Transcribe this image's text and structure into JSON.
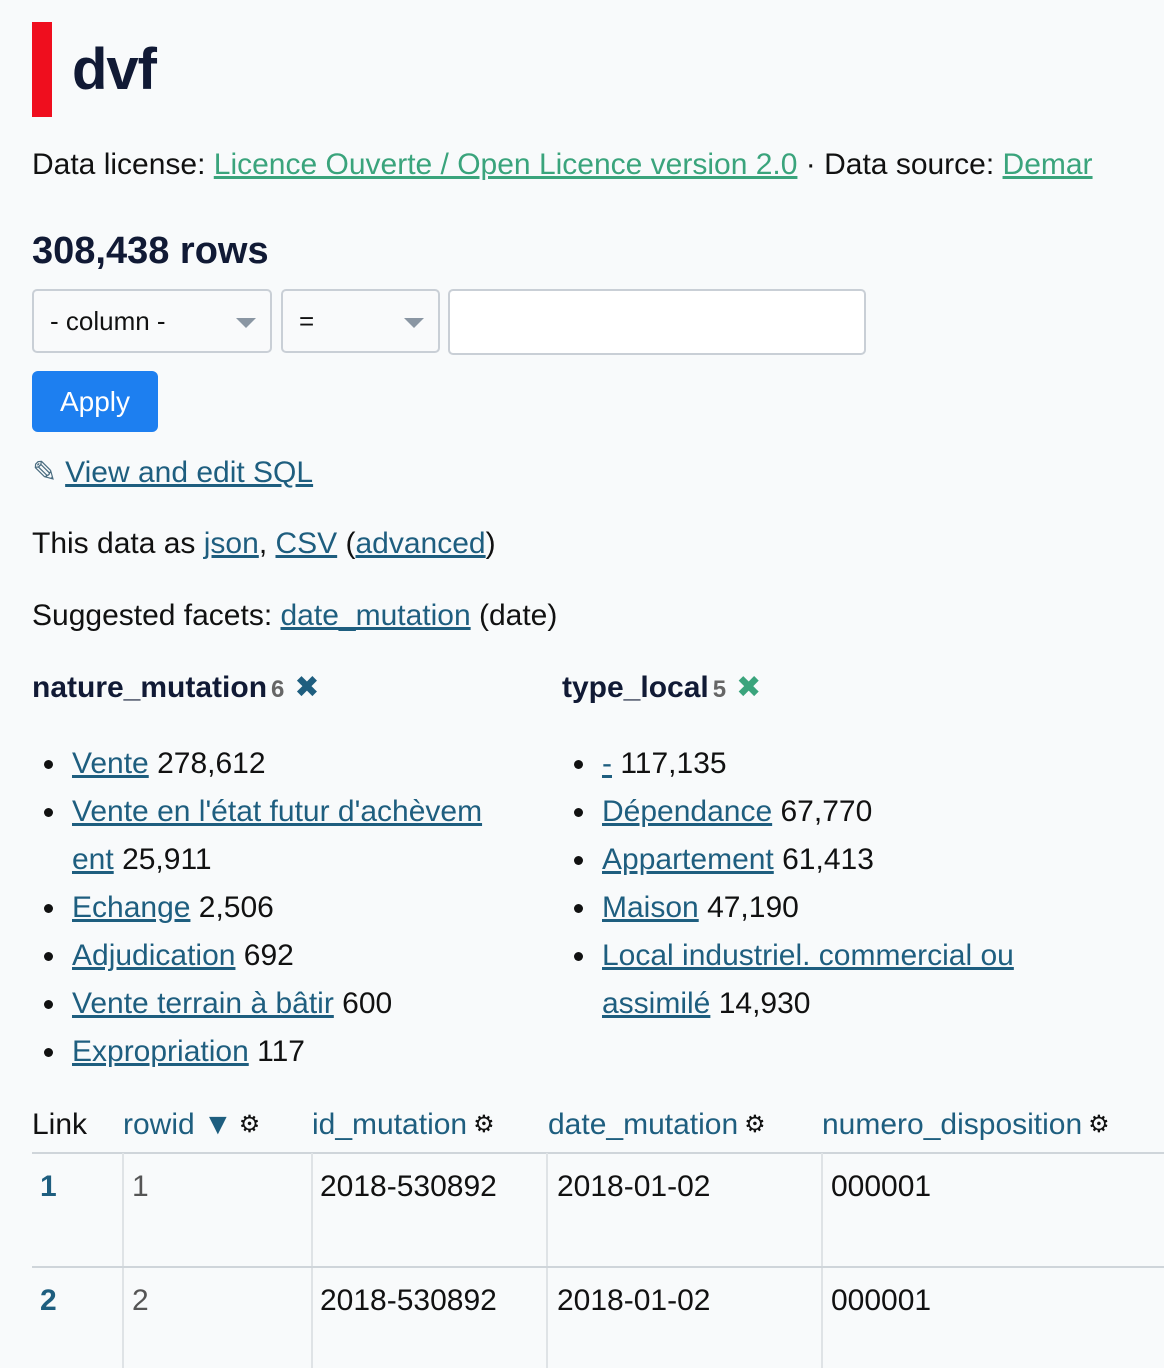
{
  "header": {
    "title": "dvf",
    "license_label": "Data license: ",
    "license_link": "Licence Ouverte / Open Licence version 2.0",
    "separator": " · ",
    "source_label": "Data source: ",
    "source_link": "Demar"
  },
  "rowcount": "308,438 rows",
  "filter": {
    "column_select": "- column -",
    "operator_select": "=",
    "value_input": "",
    "apply_label": "Apply"
  },
  "sql": {
    "pencil": "✎",
    "link": "View and edit SQL"
  },
  "export": {
    "prefix": "This data as ",
    "json": "json",
    "comma": ", ",
    "csv": "CSV",
    "open": " (",
    "advanced": "advanced",
    "close": ")"
  },
  "suggested": {
    "prefix": "Suggested facets: ",
    "link": "date_mutation",
    "suffix": " (date)"
  },
  "facets": [
    {
      "name": "nature_mutation",
      "count": "6",
      "remove": "✖",
      "remove_color": "#1e5e7f",
      "items": [
        {
          "label": "Vente",
          "value": "278,612"
        },
        {
          "label": "Vente en l'état futur d'achèvem",
          "label2": "ent",
          "value": "25,911"
        },
        {
          "label": "Echange",
          "value": "2,506"
        },
        {
          "label": "Adjudication",
          "value": "692"
        },
        {
          "label": "Vente terrain à bâtir",
          "value": "600"
        },
        {
          "label": "Expropriation",
          "value": "117"
        }
      ]
    },
    {
      "name": "type_local",
      "count": "5",
      "remove": "✖",
      "remove_color": "#3aa47c",
      "items": [
        {
          "label": "-",
          "value": "117,135"
        },
        {
          "label": "Dépendance",
          "value": "67,770"
        },
        {
          "label": "Appartement",
          "value": "61,413"
        },
        {
          "label": "Maison",
          "value": "47,190"
        },
        {
          "label": "Local industriel. commercial ou",
          "label2": "assimilé",
          "value": "14,930"
        }
      ]
    }
  ],
  "table": {
    "headers": {
      "link": "Link",
      "rowid": "rowid",
      "sort_indicator": "▼",
      "id_mutation": "id_mutation",
      "date_mutation": "date_mutation",
      "numero_disposition": "numero_disposition",
      "gear": "⚙"
    },
    "rows": [
      {
        "link": "1",
        "rowid": "1",
        "id_mutation": "2018-530892",
        "date_mutation": "2018-01-02",
        "numero_disposition": "000001"
      },
      {
        "link": "2",
        "rowid": "2",
        "id_mutation": "2018-530892",
        "date_mutation": "2018-01-02",
        "numero_disposition": "000001"
      }
    ]
  }
}
